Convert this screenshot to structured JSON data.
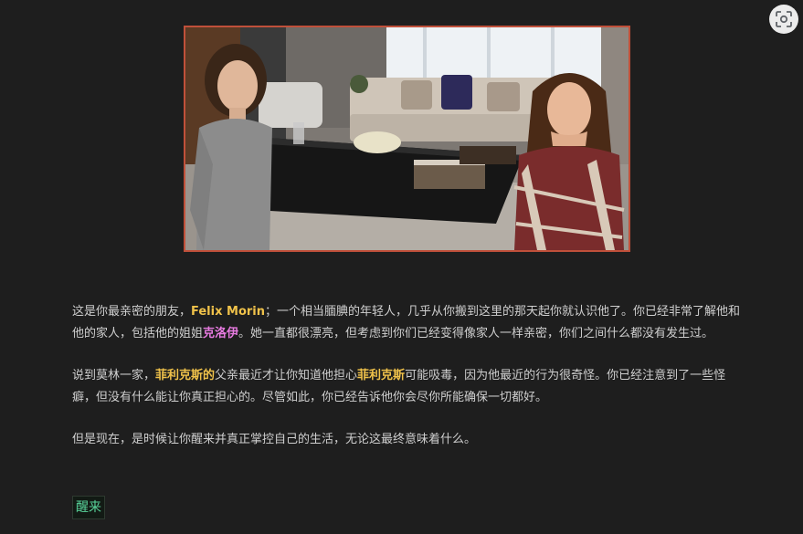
{
  "scene_image": {
    "alt": "",
    "characters": [
      "Felix Morin",
      "克洛伊"
    ]
  },
  "toolbar": {
    "lens_icon": "lens-search-icon"
  },
  "story": {
    "p1": {
      "t1": "这是你最亲密的朋友，",
      "name_felix": "Felix Morin",
      "t2": "；一个相当腼腆的年轻人，几乎从你搬到这里的那天起你就认识他了。你已经非常了解他和他的家人，包括他的姐姐",
      "name_chloe": "克洛伊",
      "t3": "。她一直都很漂亮，但考虑到你们已经变得像家人一样亲密，你们之间什么都没有发生过。"
    },
    "p2": {
      "t1": "说到莫林一家，",
      "name_felix_possessive": "菲利克斯的",
      "t2": "父亲最近才让你知道他担心",
      "name_felix": "菲利克斯",
      "t3": "可能吸毒，因为他最近的行为很奇怪。你已经注意到了一些怪癖，但没有什么能让你真正担心的。尽管如此，你已经告诉他你会尽你所能确保一切都好。"
    },
    "p3": "但是现在，是时候让你醒来并真正掌控自己的生活，无论这最终意味着什么。"
  },
  "actions": {
    "wake_label": "醒来"
  },
  "colors": {
    "background": "#1e1e1e",
    "text": "#cfcfcf",
    "highlight_yellow": "#f0c24a",
    "highlight_pink": "#e77be0",
    "link_green": "#58d39a",
    "image_border": "#c0503a"
  }
}
